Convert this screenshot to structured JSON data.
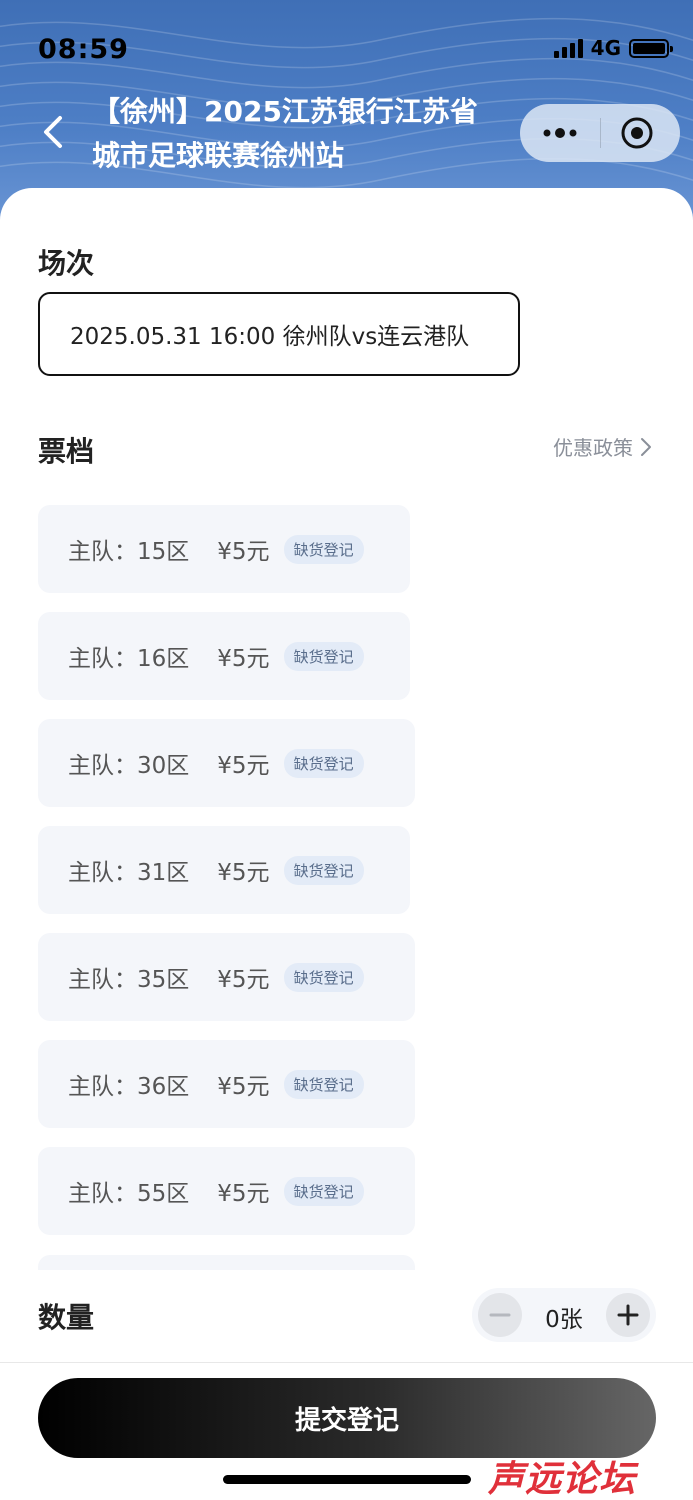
{
  "status_bar": {
    "time": "08:59",
    "network": "4G"
  },
  "header": {
    "title": "【徐州】2025江苏银行江苏省城市足球联赛徐州站"
  },
  "session": {
    "label": "场次",
    "selected": "2025.05.31 16:00 徐州队vs连云港队"
  },
  "tickets": {
    "label": "票档",
    "policy_link": "优惠政策",
    "items": [
      {
        "zone": "主队：15区",
        "price": "¥5元",
        "badge": "缺货登记"
      },
      {
        "zone": "主队：16区",
        "price": "¥5元",
        "badge": "缺货登记"
      },
      {
        "zone": "主队：30区",
        "price": "¥5元",
        "badge": "缺货登记"
      },
      {
        "zone": "主队：31区",
        "price": "¥5元",
        "badge": "缺货登记"
      },
      {
        "zone": "主队：35区",
        "price": "¥5元",
        "badge": "缺货登记"
      },
      {
        "zone": "主队：36区",
        "price": "¥5元",
        "badge": "缺货登记"
      },
      {
        "zone": "主队：55区",
        "price": "¥5元",
        "badge": "缺货登记"
      }
    ]
  },
  "quantity": {
    "label": "数量",
    "value": "0张"
  },
  "submit": {
    "label": "提交登记"
  },
  "watermark": "声远论坛",
  "icons": {
    "back": "chevron-left-icon",
    "more": "more-dots-icon",
    "close": "target-circle-icon",
    "policy_arrow": "chevron-right-icon"
  },
  "colors": {
    "header": "#4e7fc6",
    "badge_bg": "#e3ebf7",
    "button": "#000000"
  }
}
